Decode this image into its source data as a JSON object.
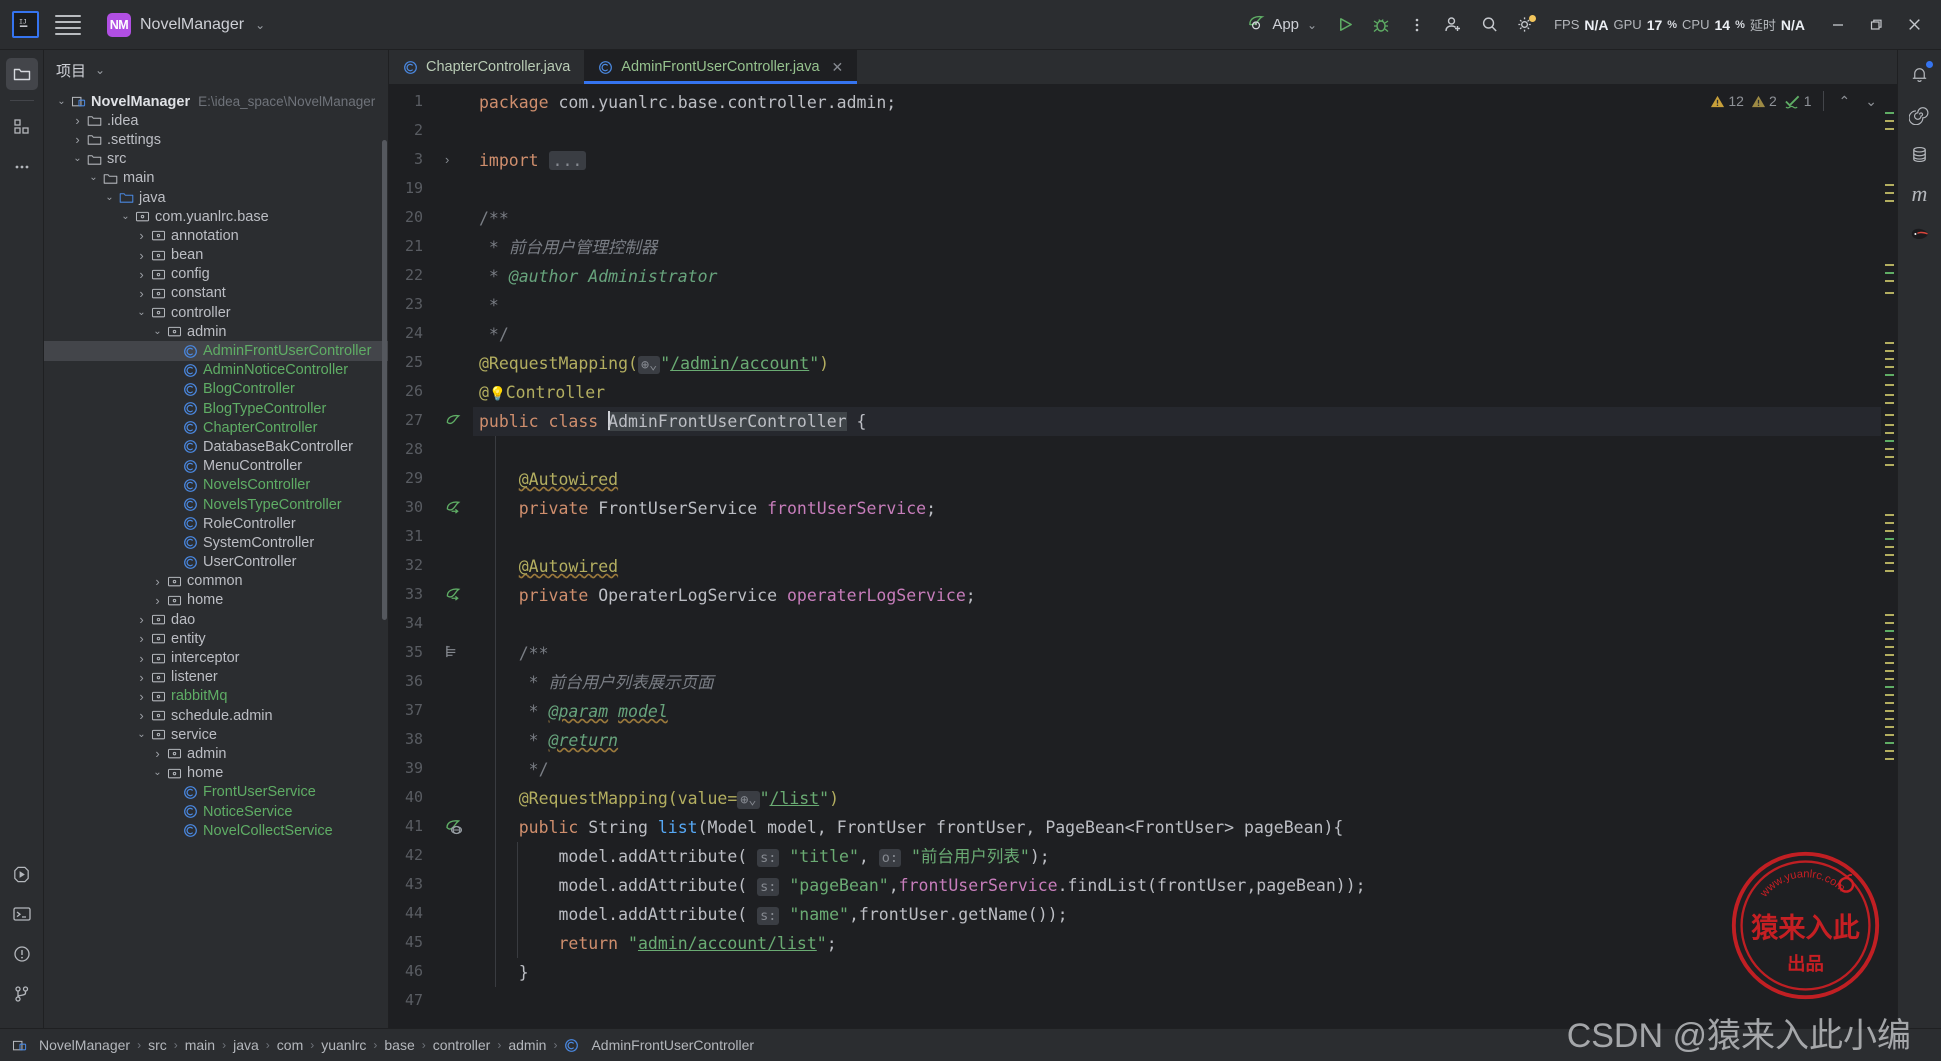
{
  "titlebar": {
    "logo_icon": "intellij-idea-logo",
    "menu_icon": "hamburger-menu-icon",
    "project_badge": "NM",
    "project_name": "NovelManager",
    "project_chevron": "⌄",
    "run_config_label": "App",
    "run_config_icon": "spring-boot-icon",
    "run_icon": "run-icon",
    "debug_icon": "debug-icon",
    "more_icon": "more-vertical-icon",
    "account_icon": "account-icon",
    "search_icon": "search-icon",
    "settings_icon": "gear-icon",
    "stats": [
      {
        "label": "FPS",
        "value": "N/A"
      },
      {
        "label": "GPU",
        "value": "17",
        "unit": "%"
      },
      {
        "label": "CPU",
        "value": "14",
        "unit": "%"
      },
      {
        "label": "延时",
        "value": "N/A"
      }
    ],
    "minimize_icon": "minimize-icon",
    "maximize_icon": "maximize-icon",
    "close_icon": "close-icon"
  },
  "left_activity_bar": {
    "items": [
      {
        "name": "project-icon",
        "selected": true
      },
      {
        "name": "structure-icon",
        "selected": false
      },
      {
        "name": "more-tools-icon",
        "selected": false
      }
    ],
    "bottom_items": [
      {
        "name": "run-tool-icon"
      },
      {
        "name": "terminal-icon"
      },
      {
        "name": "problems-icon"
      },
      {
        "name": "version-control-icon"
      }
    ]
  },
  "right_activity_bar": {
    "items": [
      {
        "name": "notifications-icon"
      },
      {
        "name": "spiral-icon"
      },
      {
        "name": "database-icon"
      },
      {
        "name": "maven-icon"
      },
      {
        "name": "ninja-icon"
      }
    ]
  },
  "tool_window": {
    "title": "项目",
    "title_chevron": "⌄",
    "tree": [
      {
        "depth": 0,
        "arrow": "v",
        "icon": "module-icon",
        "label": "NovelManager",
        "path": "E:\\idea_space\\NovelManager",
        "color": "n",
        "bold": true
      },
      {
        "depth": 1,
        "arrow": ">",
        "icon": "folder-icon",
        "label": ".idea",
        "color": "n"
      },
      {
        "depth": 1,
        "arrow": ">",
        "icon": "folder-icon",
        "label": ".settings",
        "color": "n"
      },
      {
        "depth": 1,
        "arrow": "v",
        "icon": "folder-icon",
        "label": "src",
        "color": "n"
      },
      {
        "depth": 2,
        "arrow": "v",
        "icon": "folder-icon",
        "label": "main",
        "color": "n"
      },
      {
        "depth": 3,
        "arrow": "v",
        "icon": "source-folder-icon",
        "label": "java",
        "color": "n"
      },
      {
        "depth": 4,
        "arrow": "v",
        "icon": "package-icon",
        "label": "com.yuanlrc.base",
        "color": "n"
      },
      {
        "depth": 5,
        "arrow": ">",
        "icon": "package-icon",
        "label": "annotation",
        "color": "n"
      },
      {
        "depth": 5,
        "arrow": ">",
        "icon": "package-icon",
        "label": "bean",
        "color": "n"
      },
      {
        "depth": 5,
        "arrow": ">",
        "icon": "package-icon",
        "label": "config",
        "color": "n"
      },
      {
        "depth": 5,
        "arrow": ">",
        "icon": "package-icon",
        "label": "constant",
        "color": "n"
      },
      {
        "depth": 5,
        "arrow": "v",
        "icon": "package-icon",
        "label": "controller",
        "color": "n"
      },
      {
        "depth": 6,
        "arrow": "v",
        "icon": "package-icon",
        "label": "admin",
        "color": "n"
      },
      {
        "depth": 7,
        "arrow": "",
        "icon": "class-icon",
        "label": "AdminFrontUserController",
        "color": "g",
        "selected": true
      },
      {
        "depth": 7,
        "arrow": "",
        "icon": "class-icon",
        "label": "AdminNoticeController",
        "color": "g"
      },
      {
        "depth": 7,
        "arrow": "",
        "icon": "class-icon",
        "label": "BlogController",
        "color": "g"
      },
      {
        "depth": 7,
        "arrow": "",
        "icon": "class-icon",
        "label": "BlogTypeController",
        "color": "g"
      },
      {
        "depth": 7,
        "arrow": "",
        "icon": "class-icon",
        "label": "ChapterController",
        "color": "g"
      },
      {
        "depth": 7,
        "arrow": "",
        "icon": "class-icon",
        "label": "DatabaseBakController",
        "color": "n"
      },
      {
        "depth": 7,
        "arrow": "",
        "icon": "class-icon",
        "label": "MenuController",
        "color": "n"
      },
      {
        "depth": 7,
        "arrow": "",
        "icon": "class-icon",
        "label": "NovelsController",
        "color": "g"
      },
      {
        "depth": 7,
        "arrow": "",
        "icon": "class-icon",
        "label": "NovelsTypeController",
        "color": "g"
      },
      {
        "depth": 7,
        "arrow": "",
        "icon": "class-icon",
        "label": "RoleController",
        "color": "n"
      },
      {
        "depth": 7,
        "arrow": "",
        "icon": "class-icon",
        "label": "SystemController",
        "color": "n"
      },
      {
        "depth": 7,
        "arrow": "",
        "icon": "class-icon",
        "label": "UserController",
        "color": "n"
      },
      {
        "depth": 6,
        "arrow": ">",
        "icon": "package-icon",
        "label": "common",
        "color": "n"
      },
      {
        "depth": 6,
        "arrow": ">",
        "icon": "package-icon",
        "label": "home",
        "color": "n"
      },
      {
        "depth": 5,
        "arrow": ">",
        "icon": "package-icon",
        "label": "dao",
        "color": "n"
      },
      {
        "depth": 5,
        "arrow": ">",
        "icon": "package-icon",
        "label": "entity",
        "color": "n"
      },
      {
        "depth": 5,
        "arrow": ">",
        "icon": "package-icon",
        "label": "interceptor",
        "color": "n"
      },
      {
        "depth": 5,
        "arrow": ">",
        "icon": "package-icon",
        "label": "listener",
        "color": "n"
      },
      {
        "depth": 5,
        "arrow": ">",
        "icon": "package-icon",
        "label": "rabbitMq",
        "color": "g"
      },
      {
        "depth": 5,
        "arrow": ">",
        "icon": "package-icon",
        "label": "schedule.admin",
        "color": "n"
      },
      {
        "depth": 5,
        "arrow": "v",
        "icon": "package-icon",
        "label": "service",
        "color": "n"
      },
      {
        "depth": 6,
        "arrow": ">",
        "icon": "package-icon",
        "label": "admin",
        "color": "n"
      },
      {
        "depth": 6,
        "arrow": "v",
        "icon": "package-icon",
        "label": "home",
        "color": "n"
      },
      {
        "depth": 7,
        "arrow": "",
        "icon": "class-icon",
        "label": "FrontUserService",
        "color": "g"
      },
      {
        "depth": 7,
        "arrow": "",
        "icon": "class-icon",
        "label": "NoticeService",
        "color": "g"
      },
      {
        "depth": 7,
        "arrow": "",
        "icon": "class-icon",
        "label": "NovelCollectService",
        "color": "g"
      }
    ]
  },
  "editor": {
    "tabs": [
      {
        "label": "ChapterController.java",
        "icon": "java-class-icon",
        "active": false,
        "closable": false
      },
      {
        "label": "AdminFrontUserController.java",
        "icon": "java-class-icon",
        "active": true,
        "closable": true,
        "close_glyph": "✕"
      }
    ],
    "inspections": {
      "warnings_icon": "warning-triangle-icon",
      "warnings": "12",
      "weak_warnings_icon": "weak-warning-triangle-icon",
      "weak_warnings": "2",
      "ok_icon": "inspection-ok-icon",
      "ok": "1",
      "prev_icon": "chevron-up-icon",
      "next_icon": "chevron-down-icon"
    },
    "line_numbers": [
      "1",
      "2",
      "3",
      "19",
      "20",
      "21",
      "22",
      "23",
      "24",
      "25",
      "26",
      "27",
      "28",
      "29",
      "30",
      "31",
      "32",
      "33",
      "34",
      "35",
      "36",
      "37",
      "38",
      "39",
      "40",
      "41",
      "42",
      "43",
      "44",
      "45",
      "46",
      "47"
    ],
    "code_lines": [
      "package com.yuanlrc.base.controller.admin;",
      "",
      "import ...",
      "",
      "/**",
      " * 前台用户管理控制器",
      " * @author Administrator",
      " *",
      " */",
      "@RequestMapping(\"/admin/account\")",
      "@Controller",
      "public class AdminFrontUserController {",
      "",
      "    @Autowired",
      "    private FrontUserService frontUserService;",
      "",
      "    @Autowired",
      "    private OperaterLogService operaterLogService;",
      "",
      "    /**",
      "     * 前台用户列表展示页面",
      "     * @param model",
      "     * @return",
      "     */",
      "    @RequestMapping(value=\"/list\")",
      "    public String list(Model model, FrontUser frontUser, PageBean<FrontUser> pageBean){",
      "        model.addAttribute( s: \"title\", o: \"前台用户列表\");",
      "        model.addAttribute( s: \"pageBean\",frontUserService.findList(frontUser,pageBean));",
      "        model.addAttribute( s: \"name\",frontUser.getName());",
      "        return \"admin/account/list\";",
      "    }",
      ""
    ],
    "caret_class_name": "AdminFrontUserController",
    "fold_placeholder": "...",
    "param_hints": [
      "s:",
      "o:"
    ],
    "request_mapping_paths": [
      "/admin/account",
      "/list"
    ]
  },
  "breadcrumb": {
    "root_icon": "module-icon",
    "separator": "›",
    "items": [
      "NovelManager",
      "src",
      "main",
      "java",
      "com",
      "yuanlrc",
      "base",
      "controller",
      "admin"
    ],
    "last_icon": "class-icon",
    "last": "AdminFrontUserController"
  },
  "watermark": {
    "stamp_site": "www.yuanlrc.com",
    "stamp_main": "猿来入此",
    "stamp_sub": "出品",
    "csdn_text": "CSDN @猿来入此小编"
  },
  "colors": {
    "accent_blue": "#3574f0",
    "bg_titlebar": "#2b2d30",
    "bg_editor": "#1e1f22",
    "brand_purple": "#b14fe3",
    "vcs_green": "#5fad65",
    "warning_yellow": "#b3ae60"
  }
}
